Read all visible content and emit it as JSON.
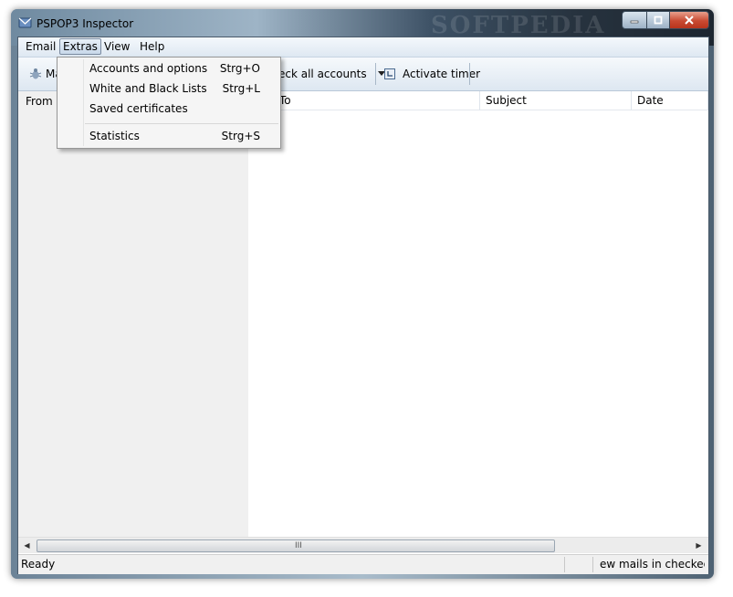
{
  "window": {
    "title": "PSPOP3 Inspector",
    "watermark": "SOFTPEDIA",
    "controls": {
      "minimize": "minimize",
      "maximize": "maximize",
      "close": "close"
    }
  },
  "menubar": {
    "items": [
      "Email",
      "Extras",
      "View",
      "Help"
    ],
    "active": "Extras"
  },
  "toolbar": {
    "partial_left_label": "Ma",
    "check_accounts_label": "eck all accounts",
    "activate_timer_label": "Activate timer"
  },
  "columns": {
    "from": "From",
    "to": "To",
    "subject": "Subject",
    "date": "Date"
  },
  "extras_menu": {
    "items": [
      {
        "label": "Accounts and options",
        "shortcut": "Strg+O"
      },
      {
        "label": "White and Black Lists",
        "shortcut": "Strg+L"
      },
      {
        "label": "Saved certificates",
        "shortcut": ""
      },
      {
        "label": "Statistics",
        "shortcut": "Strg+S"
      }
    ]
  },
  "scrollbar": {
    "grip": "III"
  },
  "status": {
    "left": "Ready",
    "right": "ew mails in checked a"
  },
  "colors": {
    "accent": "#3a7bd5",
    "close_button": "#c84a32"
  }
}
